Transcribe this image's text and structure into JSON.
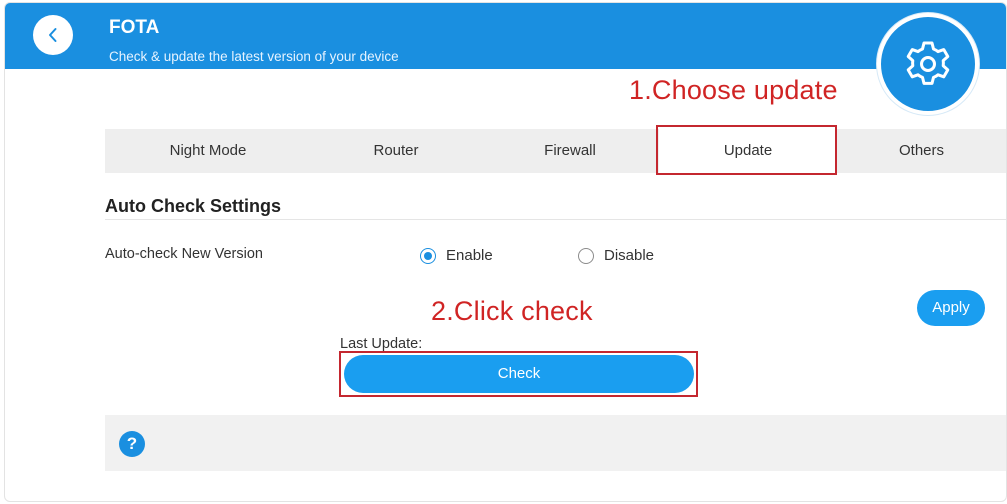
{
  "header": {
    "title": "FOTA",
    "subtitle": "Check & update the latest version of your device"
  },
  "annotations": {
    "step1": "1.Choose update",
    "step2": "2.Click check",
    "color": "#d02424"
  },
  "tabs": [
    {
      "label": "Night Mode",
      "active": false
    },
    {
      "label": "Router",
      "active": false
    },
    {
      "label": "Firewall",
      "active": false
    },
    {
      "label": "Update",
      "active": true
    },
    {
      "label": "Others",
      "active": false
    }
  ],
  "auto_check": {
    "section_title": "Auto Check Settings",
    "row_label": "Auto-check New Version",
    "options": [
      {
        "label": "Enable",
        "selected": true
      },
      {
        "label": "Disable",
        "selected": false
      }
    ],
    "apply_label": "Apply"
  },
  "update": {
    "last_update_label": "Last Update:",
    "check_label": "Check"
  },
  "help": {
    "icon_glyph": "?"
  },
  "colors": {
    "primary": "#1a8fe0",
    "button": "#1a9ef0",
    "annotation": "#c4272f"
  },
  "icons": [
    "chevron-left-icon",
    "gear-icon",
    "help-icon"
  ]
}
